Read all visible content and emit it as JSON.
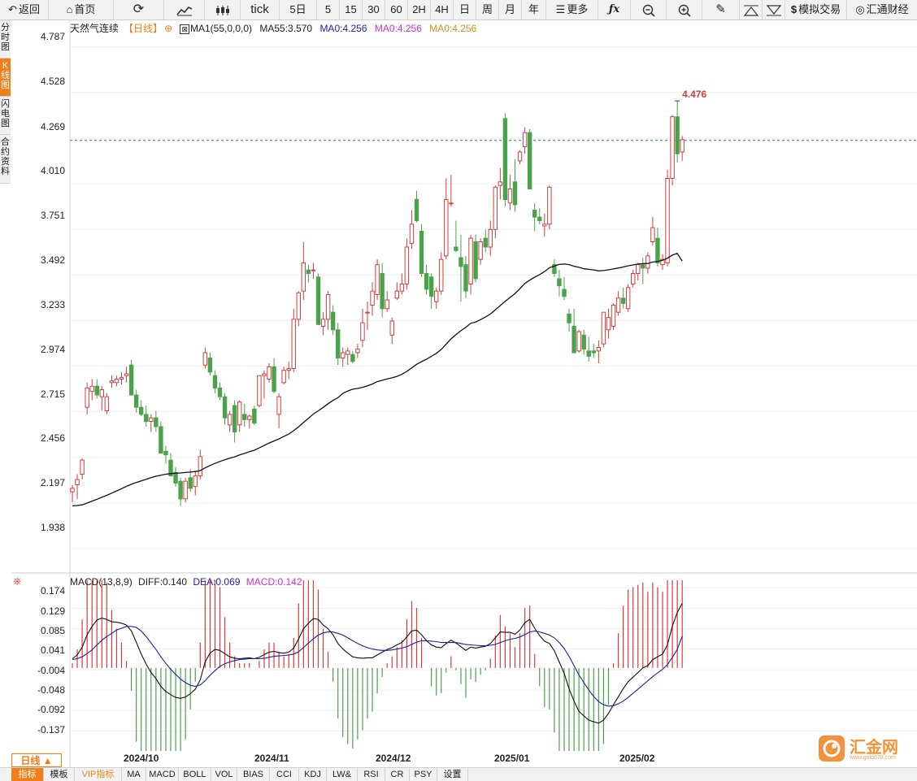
{
  "toolbar": {
    "back": "返回",
    "home": "首页",
    "tick": "tick",
    "d5": "5日",
    "m5": "5",
    "m15": "15",
    "m30": "30",
    "m60": "60",
    "h2": "2H",
    "h4": "4H",
    "day": "日",
    "week": "周",
    "month": "月",
    "year": "年",
    "more": "更多",
    "sim_trade": "模拟交易",
    "brand": "汇通财经"
  },
  "left_tabs": [
    "分时图",
    "K线图",
    "闪电图",
    "合约资料"
  ],
  "legend": {
    "title": "天然气连续",
    "period": "【日线】",
    "ma1": "MA1(55,0,0,0)",
    "ma55": "MA55:3.570",
    "ma0a": "MA0:4.256",
    "ma0b": "MA0:4.256",
    "ma0c": "MA0:4.256"
  },
  "macd_legend": {
    "name": "MACD(13,8,9)",
    "diff": "DIFF:0.140",
    "dea": "DEA:0.069",
    "macd": "MACD:0.142"
  },
  "period_tab": "日线 ▲",
  "bottom_tabs": [
    "指标",
    "模板",
    "VIP指标",
    "MA",
    "MACD",
    "BOLL",
    "VOL",
    "BIAS",
    "CCI",
    "KDJ",
    "LW&",
    "RSI",
    "CR",
    "PSY",
    "设置"
  ],
  "watermark": {
    "text": "汇金网",
    "url": "www.gold678.com"
  },
  "colors": {
    "up": "#d23e3e",
    "down": "#4aa34a",
    "ma": "#111111",
    "dea": "#1f1fa0",
    "accent": "#f07f1a",
    "macd_legend": "#cc33cc"
  },
  "chart_data": [
    {
      "type": "candlestick",
      "title": "天然气连续",
      "y_ticks": [
        "4.787",
        "4.528",
        "4.269",
        "4.010",
        "3.751",
        "3.492",
        "3.233",
        "2.974",
        "2.715",
        "2.456",
        "2.197",
        "1.938"
      ],
      "ylim": [
        1.85,
        4.85
      ],
      "x_ticks": [
        "2024/10",
        "2024/11",
        "2024/12",
        "2025/01",
        "2025/02"
      ],
      "last_price": 4.256,
      "high_label": "4.476",
      "ma55_last": 3.57,
      "candles": [
        [
          2.26,
          2.3,
          2.2,
          2.28
        ],
        [
          2.3,
          2.36,
          2.22,
          2.33
        ],
        [
          2.36,
          2.45,
          2.33,
          2.44
        ],
        [
          2.74,
          2.88,
          2.7,
          2.85
        ],
        [
          2.83,
          2.9,
          2.78,
          2.86
        ],
        [
          2.86,
          2.9,
          2.79,
          2.81
        ],
        [
          2.8,
          2.86,
          2.72,
          2.84
        ],
        [
          2.72,
          2.82,
          2.7,
          2.8
        ],
        [
          2.88,
          2.92,
          2.85,
          2.89
        ],
        [
          2.88,
          2.92,
          2.86,
          2.9
        ],
        [
          2.9,
          2.94,
          2.87,
          2.91
        ],
        [
          2.92,
          2.97,
          2.88,
          2.93
        ],
        [
          2.98,
          3.01,
          2.87,
          2.81
        ],
        [
          2.81,
          2.84,
          2.71,
          2.74
        ],
        [
          2.74,
          2.78,
          2.69,
          2.7
        ],
        [
          2.7,
          2.75,
          2.63,
          2.66
        ],
        [
          2.66,
          2.7,
          2.6,
          2.68
        ],
        [
          2.68,
          2.72,
          2.6,
          2.63
        ],
        [
          2.63,
          2.66,
          2.48,
          2.48
        ],
        [
          2.49,
          2.52,
          2.42,
          2.47
        ],
        [
          2.44,
          2.48,
          2.35,
          2.35
        ],
        [
          2.37,
          2.4,
          2.29,
          2.31
        ],
        [
          2.32,
          2.34,
          2.18,
          2.22
        ],
        [
          2.22,
          2.34,
          2.2,
          2.32
        ],
        [
          2.34,
          2.39,
          2.26,
          2.28
        ],
        [
          2.29,
          2.38,
          2.24,
          2.35
        ],
        [
          2.35,
          2.5,
          2.33,
          2.46
        ],
        [
          2.98,
          3.08,
          2.96,
          3.05
        ],
        [
          3.02,
          3.05,
          2.92,
          2.94
        ],
        [
          2.92,
          2.95,
          2.82,
          2.85
        ],
        [
          2.85,
          2.88,
          2.78,
          2.8
        ],
        [
          2.8,
          2.82,
          2.64,
          2.68
        ],
        [
          2.64,
          2.72,
          2.6,
          2.7
        ],
        [
          2.75,
          2.78,
          2.54,
          2.6
        ],
        [
          2.64,
          2.78,
          2.6,
          2.77
        ],
        [
          2.7,
          2.76,
          2.63,
          2.67
        ],
        [
          2.67,
          2.7,
          2.62,
          2.69
        ],
        [
          2.73,
          2.75,
          2.64,
          2.65
        ],
        [
          2.75,
          2.92,
          2.74,
          2.92
        ],
        [
          2.92,
          2.95,
          2.79,
          2.93
        ],
        [
          2.9,
          2.99,
          2.88,
          2.97
        ],
        [
          2.97,
          3.02,
          2.82,
          2.83
        ],
        [
          2.7,
          2.82,
          2.62,
          2.8
        ],
        [
          2.88,
          2.97,
          2.87,
          2.95
        ],
        [
          2.95,
          3.0,
          2.9,
          2.96
        ],
        [
          2.96,
          3.3,
          2.94,
          3.24
        ],
        [
          3.24,
          3.4,
          3.2,
          3.39
        ],
        [
          3.4,
          3.68,
          3.35,
          3.56
        ],
        [
          3.52,
          3.55,
          3.45,
          3.5
        ],
        [
          3.52,
          3.56,
          3.47,
          3.52
        ],
        [
          3.48,
          3.5,
          3.28,
          3.21
        ],
        [
          3.2,
          3.28,
          3.15,
          3.24
        ],
        [
          3.24,
          3.4,
          3.18,
          3.38
        ],
        [
          3.28,
          3.32,
          3.15,
          3.18
        ],
        [
          3.18,
          3.22,
          2.98,
          3.02
        ],
        [
          3.02,
          3.08,
          2.97,
          3.05
        ],
        [
          3.04,
          3.08,
          2.98,
          3.06
        ],
        [
          3.04,
          3.06,
          2.99,
          3.0
        ],
        [
          3.05,
          3.1,
          3.02,
          3.07
        ],
        [
          3.12,
          3.3,
          3.08,
          3.22
        ],
        [
          3.28,
          3.34,
          3.18,
          3.28
        ],
        [
          3.32,
          3.45,
          3.26,
          3.4
        ],
        [
          3.38,
          3.58,
          3.35,
          3.55
        ],
        [
          3.5,
          3.56,
          3.25,
          3.3
        ],
        [
          3.3,
          3.4,
          3.28,
          3.35
        ],
        [
          3.15,
          3.25,
          3.1,
          3.23
        ],
        [
          3.36,
          3.45,
          3.35,
          3.4
        ],
        [
          3.4,
          3.5,
          3.38,
          3.44
        ],
        [
          3.44,
          3.7,
          3.41,
          3.65
        ],
        [
          3.67,
          3.86,
          3.64,
          3.78
        ],
        [
          3.92,
          3.97,
          3.79,
          3.8
        ],
        [
          3.74,
          3.78,
          3.48,
          3.5
        ],
        [
          3.5,
          3.55,
          3.38,
          3.41
        ],
        [
          3.48,
          3.5,
          3.3,
          3.37
        ],
        [
          3.34,
          3.42,
          3.3,
          3.4
        ],
        [
          3.4,
          3.62,
          3.38,
          3.58
        ],
        [
          3.6,
          4.04,
          3.58,
          3.92
        ],
        [
          3.9,
          4.06,
          3.88,
          3.9
        ],
        [
          3.65,
          3.8,
          3.62,
          3.63
        ],
        [
          3.59,
          3.72,
          3.34,
          3.54
        ],
        [
          3.55,
          3.6,
          3.36,
          3.4
        ],
        [
          3.44,
          3.72,
          3.38,
          3.7
        ],
        [
          3.68,
          3.72,
          3.45,
          3.47
        ],
        [
          3.58,
          3.7,
          3.55,
          3.68
        ],
        [
          3.7,
          3.75,
          3.62,
          3.65
        ],
        [
          3.65,
          3.8,
          3.6,
          3.75
        ],
        [
          3.75,
          4.0,
          3.7,
          3.99
        ],
        [
          4.0,
          4.1,
          3.92,
          4.02
        ],
        [
          4.38,
          4.41,
          3.88,
          3.92
        ],
        [
          3.9,
          4.06,
          3.86,
          3.98
        ],
        [
          4.02,
          4.15,
          3.85,
          3.89
        ],
        [
          4.14,
          4.2,
          4.12,
          4.19
        ],
        [
          4.22,
          4.33,
          4.18,
          4.3
        ],
        [
          4.3,
          4.32,
          3.98,
          3.98
        ],
        [
          3.86,
          3.9,
          3.74,
          3.82
        ],
        [
          3.82,
          3.87,
          3.78,
          3.8
        ],
        [
          3.77,
          3.84,
          3.71,
          3.78
        ],
        [
          3.78,
          4.0,
          3.75,
          3.99
        ],
        [
          3.55,
          3.58,
          3.48,
          3.5
        ],
        [
          3.47,
          3.52,
          3.37,
          3.43
        ],
        [
          3.41,
          3.48,
          3.35,
          3.37
        ],
        [
          3.27,
          3.3,
          3.17,
          3.22
        ],
        [
          3.2,
          3.3,
          3.05,
          3.05
        ],
        [
          3.06,
          3.18,
          3.05,
          3.17
        ],
        [
          3.15,
          3.18,
          3.04,
          3.07
        ],
        [
          3.06,
          3.14,
          3.0,
          3.03
        ],
        [
          3.06,
          3.1,
          3.02,
          3.05
        ],
        [
          3.06,
          3.12,
          2.99,
          3.08
        ],
        [
          3.1,
          3.28,
          3.08,
          3.28
        ],
        [
          3.18,
          3.3,
          3.13,
          3.25
        ],
        [
          3.2,
          3.33,
          3.18,
          3.32
        ],
        [
          3.28,
          3.4,
          3.26,
          3.36
        ],
        [
          3.36,
          3.42,
          3.3,
          3.33
        ],
        [
          3.3,
          3.44,
          3.28,
          3.42
        ],
        [
          3.44,
          3.52,
          3.42,
          3.5
        ],
        [
          3.5,
          3.56,
          3.46,
          3.55
        ],
        [
          3.55,
          3.59,
          3.44,
          3.53
        ],
        [
          3.53,
          3.62,
          3.5,
          3.6
        ],
        [
          3.68,
          3.82,
          3.66,
          3.76
        ],
        [
          3.7,
          3.76,
          3.54,
          3.56
        ],
        [
          3.55,
          3.61,
          3.52,
          3.58
        ],
        [
          3.56,
          4.09,
          3.54,
          4.04
        ],
        [
          4.04,
          4.4,
          4.0,
          4.39
        ],
        [
          4.39,
          4.48,
          4.13,
          4.18
        ],
        [
          4.19,
          4.28,
          4.14,
          4.26
        ]
      ]
    },
    {
      "type": "macd",
      "title": "MACD(13,8,9)",
      "y_ticks": [
        "0.174",
        "0.129",
        "0.085",
        "0.041",
        "-0.004",
        "-0.048",
        "-0.092",
        "-0.137"
      ],
      "ylim": [
        -0.18,
        0.19
      ],
      "diff": [
        0.02,
        0.028,
        0.045,
        0.072,
        0.09,
        0.104,
        0.108,
        0.105,
        0.1,
        0.099,
        0.097,
        0.093,
        0.08,
        0.056,
        0.03,
        0.008,
        -0.01,
        -0.023,
        -0.04,
        -0.051,
        -0.058,
        -0.064,
        -0.066,
        -0.063,
        -0.056,
        -0.046,
        -0.026,
        0.013,
        0.032,
        0.04,
        0.038,
        0.031,
        0.024,
        0.021,
        0.02,
        0.021,
        0.022,
        0.02,
        0.023,
        0.029,
        0.034,
        0.036,
        0.033,
        0.032,
        0.034,
        0.043,
        0.063,
        0.085,
        0.097,
        0.107,
        0.105,
        0.093,
        0.085,
        0.072,
        0.053,
        0.041,
        0.032,
        0.024,
        0.022,
        0.021,
        0.022,
        0.022,
        0.028,
        0.034,
        0.04,
        0.044,
        0.05,
        0.055,
        0.067,
        0.08,
        0.082,
        0.072,
        0.059,
        0.05,
        0.045,
        0.044,
        0.053,
        0.06,
        0.054,
        0.046,
        0.038,
        0.045,
        0.043,
        0.045,
        0.047,
        0.053,
        0.065,
        0.078,
        0.077,
        0.077,
        0.073,
        0.082,
        0.098,
        0.105,
        0.086,
        0.07,
        0.058,
        0.053,
        0.037,
        0.013,
        -0.012,
        -0.045,
        -0.072,
        -0.094,
        -0.104,
        -0.113,
        -0.117,
        -0.12,
        -0.113,
        -0.099,
        -0.08,
        -0.063,
        -0.045,
        -0.03,
        -0.02,
        -0.01,
        0.0,
        0.005,
        0.018,
        0.024,
        0.03,
        0.05,
        0.091,
        0.12,
        0.14
      ],
      "dea": [
        0.018,
        0.02,
        0.024,
        0.031,
        0.039,
        0.05,
        0.06,
        0.068,
        0.075,
        0.082,
        0.086,
        0.09,
        0.09,
        0.088,
        0.08,
        0.068,
        0.054,
        0.04,
        0.024,
        0.01,
        -0.003,
        -0.014,
        -0.024,
        -0.032,
        -0.038,
        -0.04,
        -0.037,
        -0.028,
        -0.016,
        -0.006,
        0.003,
        0.009,
        0.013,
        0.016,
        0.018,
        0.019,
        0.02,
        0.02,
        0.02,
        0.021,
        0.023,
        0.025,
        0.026,
        0.027,
        0.028,
        0.03,
        0.035,
        0.044,
        0.054,
        0.063,
        0.071,
        0.076,
        0.078,
        0.078,
        0.075,
        0.071,
        0.065,
        0.059,
        0.053,
        0.048,
        0.044,
        0.041,
        0.039,
        0.038,
        0.038,
        0.039,
        0.041,
        0.043,
        0.046,
        0.051,
        0.056,
        0.059,
        0.059,
        0.058,
        0.057,
        0.055,
        0.055,
        0.055,
        0.055,
        0.053,
        0.051,
        0.05,
        0.049,
        0.048,
        0.048,
        0.049,
        0.051,
        0.055,
        0.059,
        0.062,
        0.064,
        0.067,
        0.072,
        0.078,
        0.08,
        0.078,
        0.075,
        0.071,
        0.065,
        0.055,
        0.042,
        0.025,
        0.005,
        -0.015,
        -0.032,
        -0.048,
        -0.062,
        -0.073,
        -0.08,
        -0.083,
        -0.082,
        -0.078,
        -0.072,
        -0.064,
        -0.055,
        -0.046,
        -0.037,
        -0.028,
        -0.019,
        -0.011,
        -0.003,
        0.007,
        0.023,
        0.04,
        0.069
      ]
    }
  ]
}
